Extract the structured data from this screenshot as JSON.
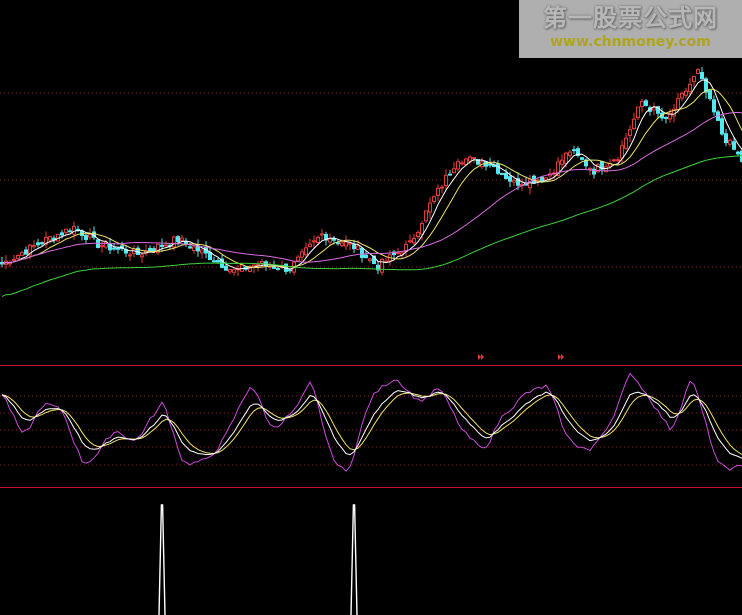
{
  "watermark": {
    "title": "第一股票公式网",
    "url": "www.chnmoney.com"
  },
  "colors": {
    "background": "#000000",
    "panel_border": "#c8102e",
    "grid": "#8a1f1f",
    "candle_up": "#e23b3b",
    "candle_down": "#54e8f0",
    "ma_short": "#ffffff",
    "ma_mid": "#f0e36a",
    "ma_long": "#d86be0",
    "ma_vlong": "#3cd33c",
    "kdj_k": "#ffffff",
    "kdj_d": "#f0e36a",
    "kdj_j": "#c84bd8",
    "signal": "#ffffff",
    "marker": "#e23b3b"
  },
  "chart_data": {
    "type": "candlestick",
    "title": "",
    "xlabel": "",
    "ylabel": "",
    "price_ylim": [
      0,
      100
    ],
    "grid": true,
    "trend_anchors": [
      [
        0,
        22
      ],
      [
        10,
        31
      ],
      [
        18,
        37
      ],
      [
        24,
        30
      ],
      [
        34,
        26
      ],
      [
        44,
        32
      ],
      [
        52,
        25
      ],
      [
        58,
        19
      ],
      [
        64,
        22
      ],
      [
        72,
        20
      ],
      [
        80,
        34
      ],
      [
        88,
        29
      ],
      [
        94,
        21
      ],
      [
        102,
        30
      ],
      [
        107,
        46
      ],
      [
        114,
        65
      ],
      [
        122,
        63
      ],
      [
        128,
        55
      ],
      [
        136,
        57
      ],
      [
        142,
        68
      ],
      [
        148,
        60
      ],
      [
        154,
        66
      ],
      [
        160,
        88
      ],
      [
        166,
        80
      ],
      [
        174,
        100
      ],
      [
        180,
        75
      ],
      [
        185,
        64
      ]
    ],
    "indicator_ylim": [
      0,
      100
    ],
    "indicator_anchors": [
      [
        0,
        90
      ],
      [
        5,
        55
      ],
      [
        10,
        78
      ],
      [
        15,
        72
      ],
      [
        20,
        30
      ],
      [
        24,
        35
      ],
      [
        28,
        50
      ],
      [
        33,
        42
      ],
      [
        40,
        75
      ],
      [
        45,
        30
      ],
      [
        51,
        25
      ],
      [
        56,
        45
      ],
      [
        62,
        90
      ],
      [
        67,
        60
      ],
      [
        73,
        72
      ],
      [
        77,
        95
      ],
      [
        82,
        40
      ],
      [
        86,
        20
      ],
      [
        92,
        75
      ],
      [
        98,
        100
      ],
      [
        104,
        85
      ],
      [
        109,
        95
      ],
      [
        115,
        60
      ],
      [
        120,
        40
      ],
      [
        125,
        65
      ],
      [
        131,
        85
      ],
      [
        136,
        95
      ],
      [
        141,
        55
      ],
      [
        147,
        38
      ],
      [
        152,
        60
      ],
      [
        157,
        100
      ],
      [
        162,
        85
      ],
      [
        167,
        60
      ],
      [
        172,
        100
      ],
      [
        179,
        30
      ],
      [
        185,
        20
      ]
    ],
    "signal_bars_index": [
      40,
      88
    ],
    "markers_index": [
      119,
      139
    ]
  }
}
